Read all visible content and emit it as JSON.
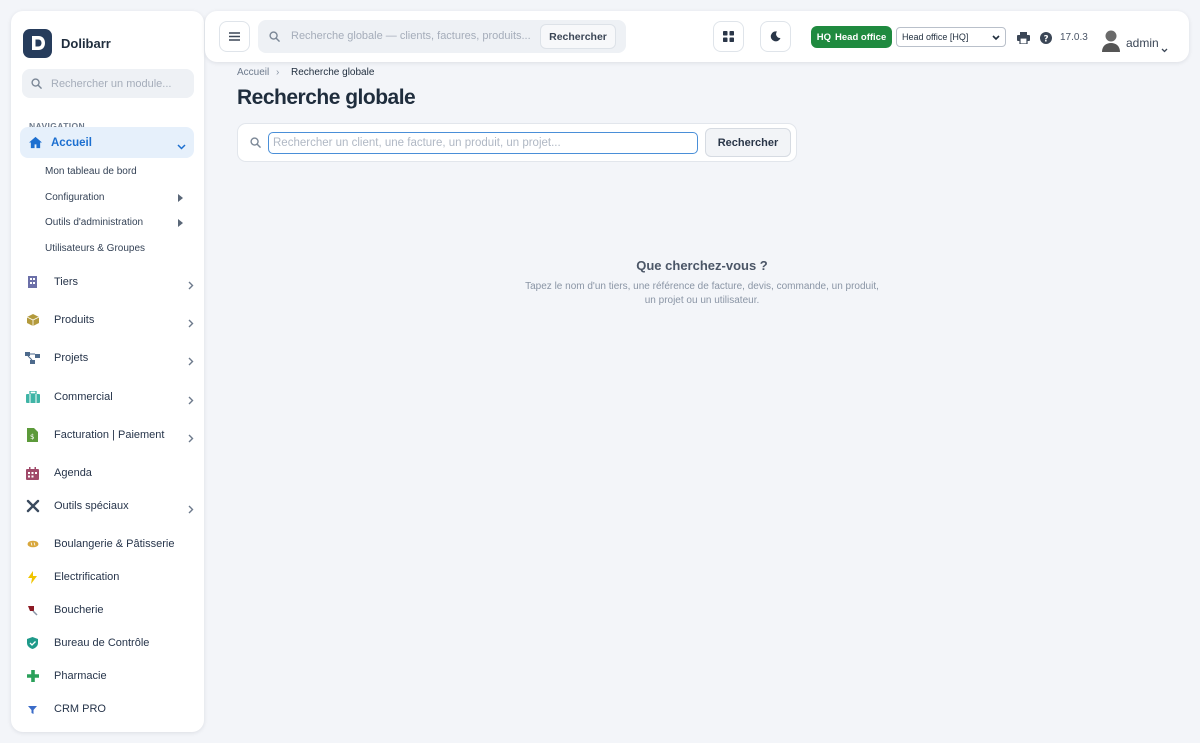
{
  "app": {
    "name": "Dolibarr",
    "logo_letter": "D"
  },
  "sidebar": {
    "search_placeholder": "Rechercher un module...",
    "nav_title": "NAVIGATION",
    "active": {
      "label": "Accueil"
    },
    "subitems": [
      {
        "label": "Mon tableau de bord"
      },
      {
        "label": "Configuration"
      },
      {
        "label": "Outils d'administration"
      },
      {
        "label": "Utilisateurs & Groupes"
      }
    ],
    "items": [
      {
        "label": "Tiers",
        "icon": "building-icon"
      },
      {
        "label": "Produits",
        "icon": "box-icon"
      },
      {
        "label": "Projets",
        "icon": "project-icon"
      },
      {
        "label": "Commercial",
        "icon": "briefcase-icon"
      },
      {
        "label": "Facturation | Paiement",
        "icon": "invoice-icon"
      },
      {
        "label": "Agenda",
        "icon": "calendar-icon"
      },
      {
        "label": "Outils spéciaux",
        "icon": "tools-icon"
      },
      {
        "label": "Boulangerie & Pâtisserie",
        "icon": "bread-icon"
      },
      {
        "label": "Electrification",
        "icon": "bolt-icon"
      },
      {
        "label": "Boucherie",
        "icon": "meat-icon"
      },
      {
        "label": "Bureau de Contrôle",
        "icon": "shield-icon"
      },
      {
        "label": "Pharmacie",
        "icon": "cross-icon"
      },
      {
        "label": "CRM PRO",
        "icon": "funnel-icon"
      }
    ]
  },
  "topbar": {
    "search_placeholder": "Recherche globale — clients, factures, produits...",
    "search_button": "Rechercher",
    "hq_badge_prefix": "HQ",
    "hq_badge_label": "Head office",
    "entity_select": "Head office [HQ]",
    "version": "17.0.3",
    "user": "admin"
  },
  "main": {
    "breadcrumb": [
      "Accueil",
      "Recherche globale"
    ],
    "title": "Recherche globale",
    "search_placeholder": "Rechercher un client, une facture, un produit, un projet...",
    "search_button": "Rechercher",
    "empty_title": "Que cherchez-vous ?",
    "empty_text": "Tapez le nom d'un tiers, une référence de facture, devis, commande, un produit, un projet ou un utilisateur."
  },
  "colors": {
    "accent": "#1c6fd0",
    "hq_green": "#1f8a3f",
    "brand_dark": "#263c5c"
  }
}
